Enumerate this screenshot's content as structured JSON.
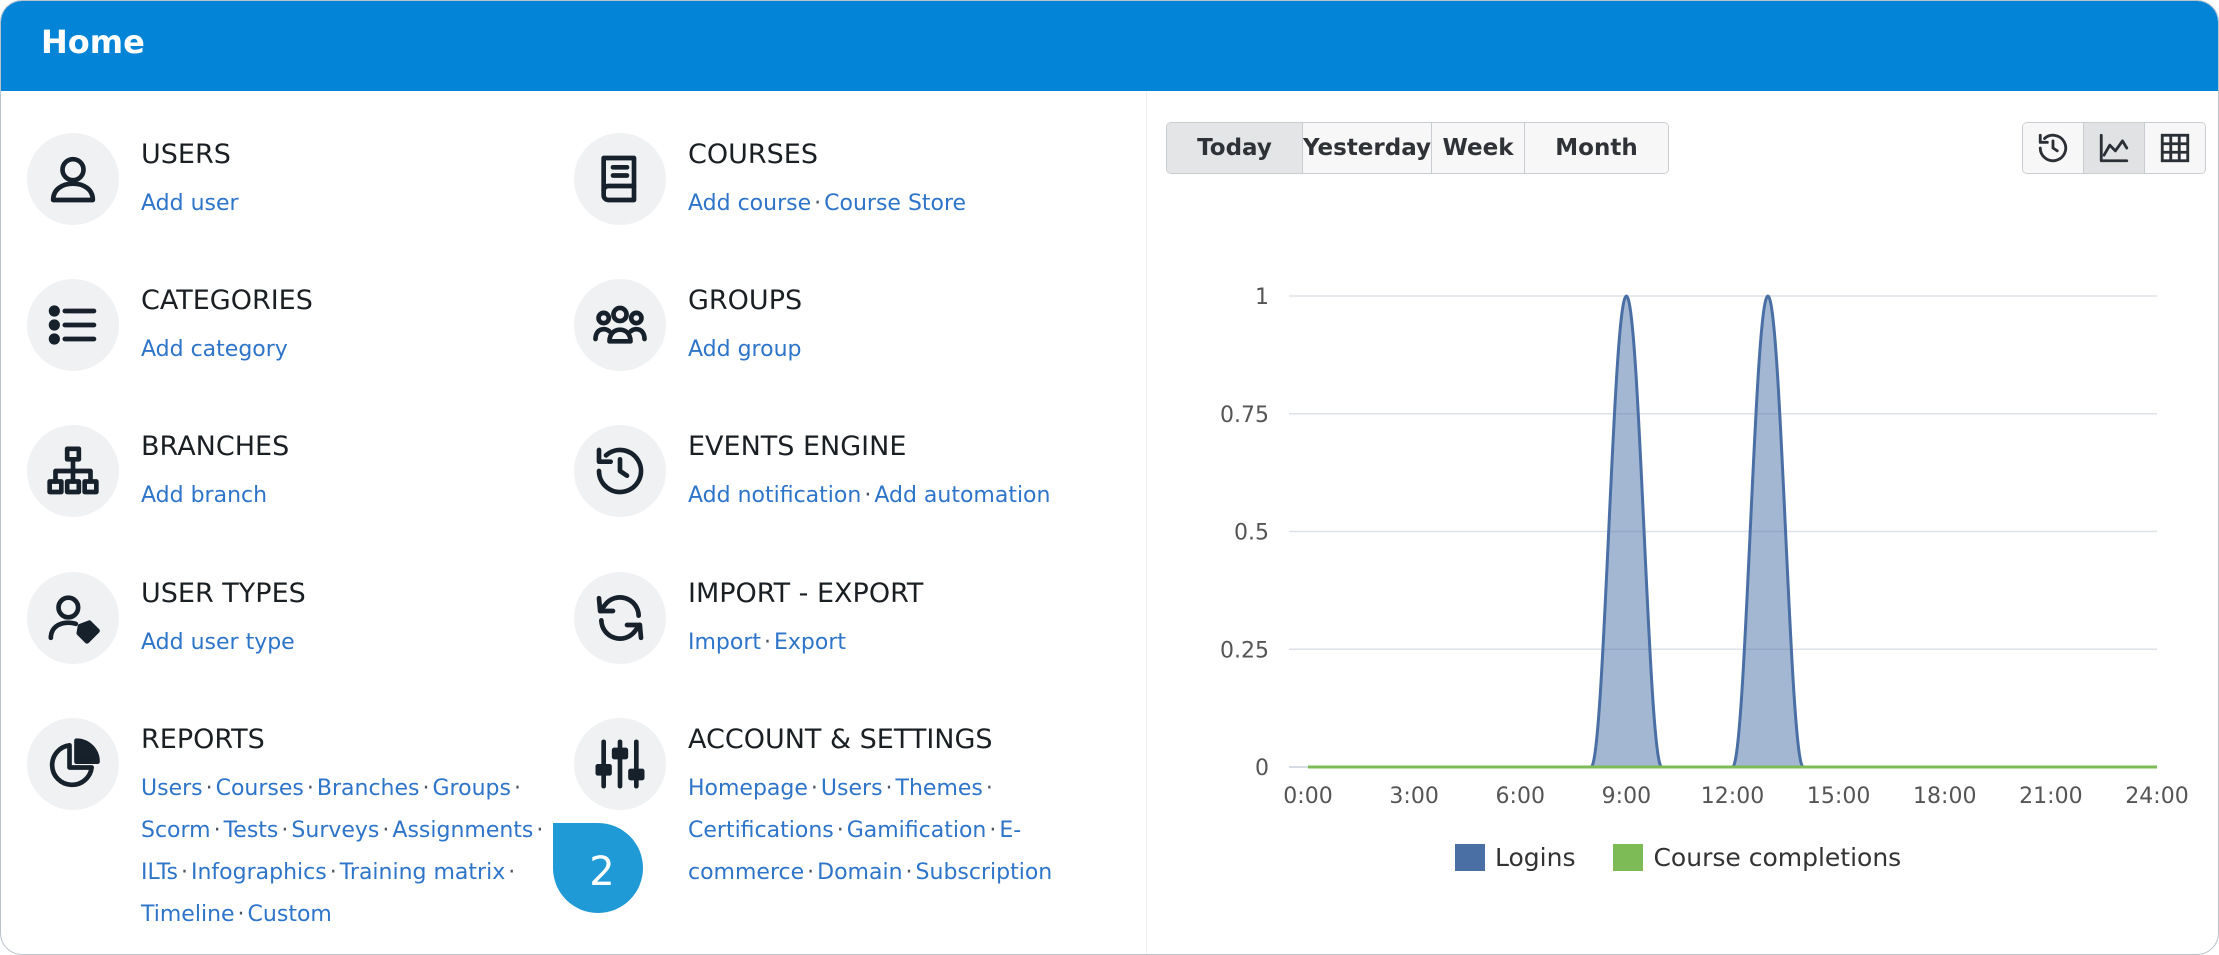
{
  "header": {
    "title": "Home"
  },
  "tiles": [
    {
      "id": "users",
      "name": "USERS",
      "icon": "user-icon",
      "lines": [
        [
          "Add user"
        ]
      ]
    },
    {
      "id": "courses",
      "name": "COURSES",
      "icon": "book-icon",
      "lines": [
        [
          "Add course",
          "Course Store"
        ]
      ]
    },
    {
      "id": "categories",
      "name": "CATEGORIES",
      "icon": "list-icon",
      "lines": [
        [
          "Add category"
        ]
      ]
    },
    {
      "id": "groups",
      "name": "GROUPS",
      "icon": "group-icon",
      "lines": [
        [
          "Add group"
        ]
      ]
    },
    {
      "id": "branches",
      "name": "BRANCHES",
      "icon": "sitemap-icon",
      "lines": [
        [
          "Add branch"
        ]
      ]
    },
    {
      "id": "events",
      "name": "EVENTS ENGINE",
      "icon": "history-icon",
      "lines": [
        [
          "Add notification",
          "Add automation"
        ]
      ]
    },
    {
      "id": "usertypes",
      "name": "USER TYPES",
      "icon": "user-tag-icon",
      "lines": [
        [
          "Add user type"
        ]
      ]
    },
    {
      "id": "importexport",
      "name": "IMPORT - EXPORT",
      "icon": "sync-icon",
      "lines": [
        [
          "Import",
          "Export"
        ]
      ]
    },
    {
      "id": "reports",
      "name": "REPORTS",
      "icon": "pie-chart-icon",
      "lines": [
        [
          "Users",
          "Courses",
          "Branches",
          "Groups",
          ""
        ],
        [
          "Scorm",
          "Tests",
          "Surveys",
          "Assignments",
          ""
        ],
        [
          "ILTs",
          "Infographics",
          "Training matrix",
          ""
        ],
        [
          "Timeline",
          "Custom"
        ]
      ]
    },
    {
      "id": "account",
      "name": "ACCOUNT & SETTINGS",
      "icon": "sliders-icon",
      "lines": [
        [
          "Homepage",
          "Users",
          "Themes",
          ""
        ],
        [
          "Certifications",
          "Gamification",
          "E-"
        ],
        [
          "commerce",
          "Domain",
          "Subscription"
        ]
      ]
    }
  ],
  "period_tabs": [
    {
      "label": "Today",
      "active": true
    },
    {
      "label": "Yesterday",
      "active": false
    },
    {
      "label": "Week",
      "active": false
    },
    {
      "label": "Month",
      "active": false
    }
  ],
  "view_buttons": [
    {
      "icon": "history-icon",
      "active": false
    },
    {
      "icon": "area-chart-icon",
      "active": true
    },
    {
      "icon": "table-icon",
      "active": false
    }
  ],
  "chart_data": {
    "type": "area",
    "x_ticks": [
      "0:00",
      "3:00",
      "6:00",
      "9:00",
      "12:00",
      "15:00",
      "18:00",
      "21:00",
      "24:00"
    ],
    "x_range": [
      0,
      24
    ],
    "y_ticks": [
      "1",
      "0.75",
      "0.5",
      "0.25",
      "0"
    ],
    "ylim": [
      0,
      1
    ],
    "grid": true,
    "legend_position": "bottom",
    "series": [
      {
        "name": "Logins",
        "color": "#4a6fa5",
        "x": [
          0,
          1,
          2,
          3,
          4,
          5,
          6,
          7,
          8,
          9,
          10,
          11,
          12,
          13,
          14,
          15,
          16,
          17,
          18,
          19,
          20,
          21,
          22,
          23,
          24
        ],
        "values": [
          0,
          0,
          0,
          0,
          0,
          0,
          0,
          0,
          0,
          1,
          0,
          0,
          0,
          1,
          0,
          0,
          0,
          0,
          0,
          0,
          0,
          0,
          0,
          0,
          0
        ]
      },
      {
        "name": "Course completions",
        "color": "#7dbb57",
        "x": [
          0,
          1,
          2,
          3,
          4,
          5,
          6,
          7,
          8,
          9,
          10,
          11,
          12,
          13,
          14,
          15,
          16,
          17,
          18,
          19,
          20,
          21,
          22,
          23,
          24
        ],
        "values": [
          0,
          0,
          0,
          0,
          0,
          0,
          0,
          0,
          0,
          0,
          0,
          0,
          0,
          0,
          0,
          0,
          0,
          0,
          0,
          0,
          0,
          0,
          0,
          0,
          0
        ]
      }
    ]
  },
  "badge": {
    "value": "2",
    "color": "#1f9ad6"
  }
}
